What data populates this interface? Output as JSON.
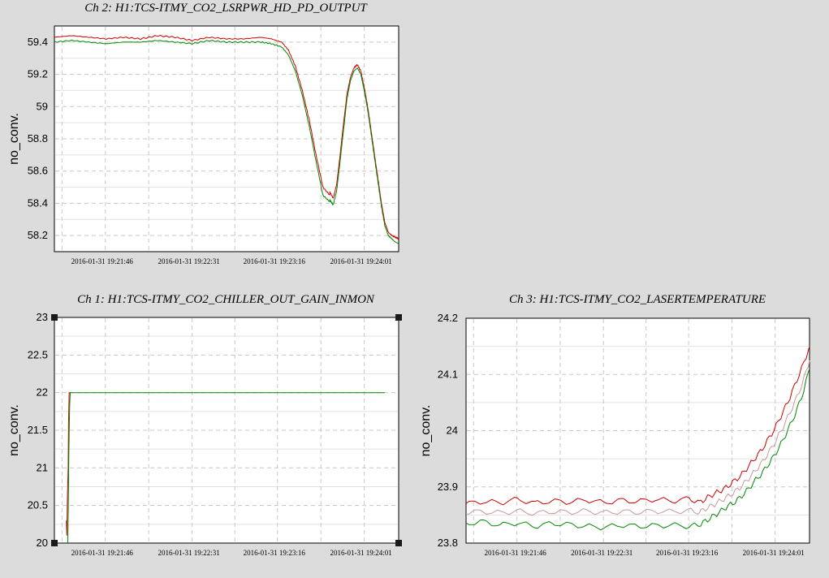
{
  "chart_data": [
    {
      "id": "ch2",
      "type": "line",
      "title": "Ch 2: H1:TCS-ITMY_CO2_LSRPWR_HD_PD_OUTPUT",
      "xlabel": "",
      "ylabel": "no_conv.",
      "ylim": [
        58.1,
        59.5
      ],
      "xlim": [
        0,
        1
      ],
      "y_ticks": [
        58.2,
        58.4,
        58.6,
        58.8,
        59,
        59.2,
        59.4
      ],
      "y_tick_labels": [
        "58.2",
        "58.4",
        "58.6",
        "58.8",
        "59",
        "59.2",
        "59.4"
      ],
      "x_ticks": [
        0.148,
        0.4,
        0.648,
        0.9
      ],
      "x_tick_labels": [
        "2016-01-31 19:21:46",
        "2016-01-31 19:22:31",
        "2016-01-31 19:23:16",
        "2016-01-31 19:24:01"
      ],
      "grid": true,
      "series": [
        {
          "color": "#cc0000",
          "x": [
            0,
            0.05,
            0.1,
            0.15,
            0.2,
            0.25,
            0.3,
            0.35,
            0.4,
            0.45,
            0.5,
            0.55,
            0.6,
            0.63,
            0.66,
            0.68,
            0.7,
            0.72,
            0.74,
            0.76,
            0.78,
            0.8,
            0.8,
            0.81,
            0.82,
            0.83,
            0.84,
            0.85,
            0.86,
            0.87,
            0.88,
            0.89,
            0.9,
            0.91,
            0.92,
            0.93,
            0.94,
            0.95,
            0.96,
            0.97,
            0.98,
            0.99,
            1.0
          ],
          "values": [
            59.43,
            59.44,
            59.43,
            59.42,
            59.43,
            59.42,
            59.44,
            59.43,
            59.41,
            59.43,
            59.42,
            59.42,
            59.43,
            59.42,
            59.4,
            59.35,
            59.25,
            59.1,
            58.92,
            58.7,
            58.5,
            58.45,
            58.47,
            58.43,
            58.52,
            58.7,
            58.9,
            59.08,
            59.18,
            59.24,
            59.26,
            59.22,
            59.12,
            59.0,
            58.85,
            58.7,
            58.55,
            58.4,
            58.28,
            58.22,
            58.2,
            58.19,
            58.18
          ]
        },
        {
          "color": "#008800",
          "x": [
            0,
            0.05,
            0.1,
            0.15,
            0.2,
            0.25,
            0.3,
            0.35,
            0.4,
            0.45,
            0.5,
            0.55,
            0.6,
            0.63,
            0.66,
            0.68,
            0.7,
            0.72,
            0.74,
            0.76,
            0.78,
            0.8,
            0.8,
            0.81,
            0.82,
            0.83,
            0.84,
            0.85,
            0.86,
            0.87,
            0.88,
            0.89,
            0.9,
            0.91,
            0.92,
            0.93,
            0.94,
            0.95,
            0.96,
            0.97,
            0.98,
            0.99,
            1.0
          ],
          "values": [
            59.4,
            59.41,
            59.4,
            59.39,
            59.4,
            59.4,
            59.41,
            59.4,
            59.39,
            59.41,
            59.4,
            59.4,
            59.4,
            59.39,
            59.37,
            59.32,
            59.22,
            59.07,
            58.88,
            58.66,
            58.45,
            58.41,
            58.42,
            58.39,
            58.48,
            58.66,
            58.86,
            59.05,
            59.16,
            59.22,
            59.24,
            59.2,
            59.1,
            58.98,
            58.83,
            58.68,
            58.53,
            58.38,
            58.26,
            58.2,
            58.18,
            58.16,
            58.15
          ]
        }
      ]
    },
    {
      "id": "ch1",
      "type": "line",
      "title": "Ch 1: H1:TCS-ITMY_CO2_CHILLER_OUT_GAIN_INMON",
      "xlabel": "",
      "ylabel": "no_conv.",
      "ylim": [
        20,
        23
      ],
      "xlim": [
        0,
        1
      ],
      "y_ticks": [
        20,
        20.5,
        21,
        21.5,
        22,
        22.5,
        23
      ],
      "y_tick_labels": [
        "20",
        "20.5",
        "21",
        "21.5",
        "22",
        "22.5",
        "23"
      ],
      "x_ticks": [
        0.148,
        0.4,
        0.648,
        0.9
      ],
      "x_tick_labels": [
        "2016-01-31 19:21:46",
        "2016-01-31 19:22:31",
        "2016-01-31 19:23:16",
        "2016-01-31 19:24:01"
      ],
      "grid": true,
      "series": [
        {
          "color": "#cc0000",
          "x": [
            0.035,
            0.036,
            0.038,
            0.04,
            0.041,
            0.043,
            0.045,
            0.047
          ],
          "values": [
            20.3,
            20.1,
            20.65,
            21.0,
            21.6,
            22.0,
            22.0,
            22.0
          ]
        },
        {
          "color": "#008800",
          "x": [
            0.039,
            0.04,
            0.042,
            0.044,
            0.046,
            0.05,
            0.3,
            0.6,
            0.96
          ],
          "values": [
            20.0,
            20.4,
            21.2,
            21.8,
            22.0,
            22.0,
            22.0,
            22.0,
            22.0
          ]
        }
      ]
    },
    {
      "id": "ch3",
      "type": "line",
      "title": "Ch 3: H1:TCS-ITMY_CO2_LASERTEMPERATURE",
      "xlabel": "",
      "ylabel": "no_conv.",
      "ylim": [
        23.8,
        24.2
      ],
      "xlim": [
        0,
        1
      ],
      "y_ticks": [
        23.8,
        23.9,
        24,
        24.1,
        24.2
      ],
      "y_tick_labels": [
        "23.8",
        "23.9",
        "24",
        "24.1",
        "24.2"
      ],
      "x_ticks": [
        0.148,
        0.4,
        0.648,
        0.9
      ],
      "x_tick_labels": [
        "2016-01-31 19:21:46",
        "2016-01-31 19:22:31",
        "2016-01-31 19:23:16",
        "2016-01-31 19:24:01"
      ],
      "grid": true,
      "series": [
        {
          "color": "#cc0000",
          "x": [
            0,
            0.05,
            0.1,
            0.15,
            0.2,
            0.25,
            0.3,
            0.35,
            0.4,
            0.45,
            0.5,
            0.55,
            0.6,
            0.65,
            0.68,
            0.7,
            0.72,
            0.74,
            0.76,
            0.78,
            0.8,
            0.82,
            0.84,
            0.86,
            0.88,
            0.9,
            0.92,
            0.94,
            0.96,
            0.98,
            1.0
          ],
          "values": [
            23.87,
            23.874,
            23.872,
            23.878,
            23.871,
            23.875,
            23.873,
            23.877,
            23.872,
            23.876,
            23.874,
            23.878,
            23.875,
            23.879,
            23.872,
            23.88,
            23.887,
            23.893,
            23.9,
            23.91,
            23.92,
            23.935,
            23.95,
            23.965,
            23.985,
            24.005,
            24.03,
            24.055,
            24.085,
            24.115,
            24.15
          ]
        },
        {
          "color": "#c89898",
          "x": [
            0,
            0.05,
            0.1,
            0.15,
            0.2,
            0.25,
            0.3,
            0.35,
            0.4,
            0.45,
            0.5,
            0.55,
            0.6,
            0.65,
            0.68,
            0.7,
            0.72,
            0.74,
            0.76,
            0.78,
            0.8,
            0.82,
            0.84,
            0.86,
            0.88,
            0.9,
            0.92,
            0.94,
            0.96,
            0.98,
            1.0
          ],
          "values": [
            23.855,
            23.856,
            23.854,
            23.857,
            23.853,
            23.856,
            23.855,
            23.857,
            23.854,
            23.856,
            23.855,
            23.857,
            23.856,
            23.858,
            23.855,
            23.862,
            23.868,
            23.875,
            23.882,
            23.89,
            23.9,
            23.913,
            23.927,
            23.942,
            23.96,
            23.98,
            24.003,
            24.028,
            24.055,
            24.085,
            24.125
          ]
        },
        {
          "color": "#008800",
          "x": [
            0,
            0.05,
            0.1,
            0.15,
            0.2,
            0.25,
            0.3,
            0.35,
            0.4,
            0.45,
            0.5,
            0.55,
            0.6,
            0.65,
            0.68,
            0.7,
            0.72,
            0.74,
            0.76,
            0.78,
            0.8,
            0.82,
            0.84,
            0.86,
            0.88,
            0.9,
            0.92,
            0.94,
            0.96,
            0.98,
            1.0
          ],
          "values": [
            23.835,
            23.838,
            23.832,
            23.836,
            23.83,
            23.835,
            23.833,
            23.83,
            23.828,
            23.832,
            23.83,
            23.831,
            23.832,
            23.83,
            23.833,
            23.84,
            23.848,
            23.856,
            23.865,
            23.872,
            23.882,
            23.895,
            23.91,
            23.923,
            23.94,
            23.958,
            23.98,
            24.005,
            24.032,
            24.065,
            24.11
          ]
        }
      ]
    }
  ]
}
